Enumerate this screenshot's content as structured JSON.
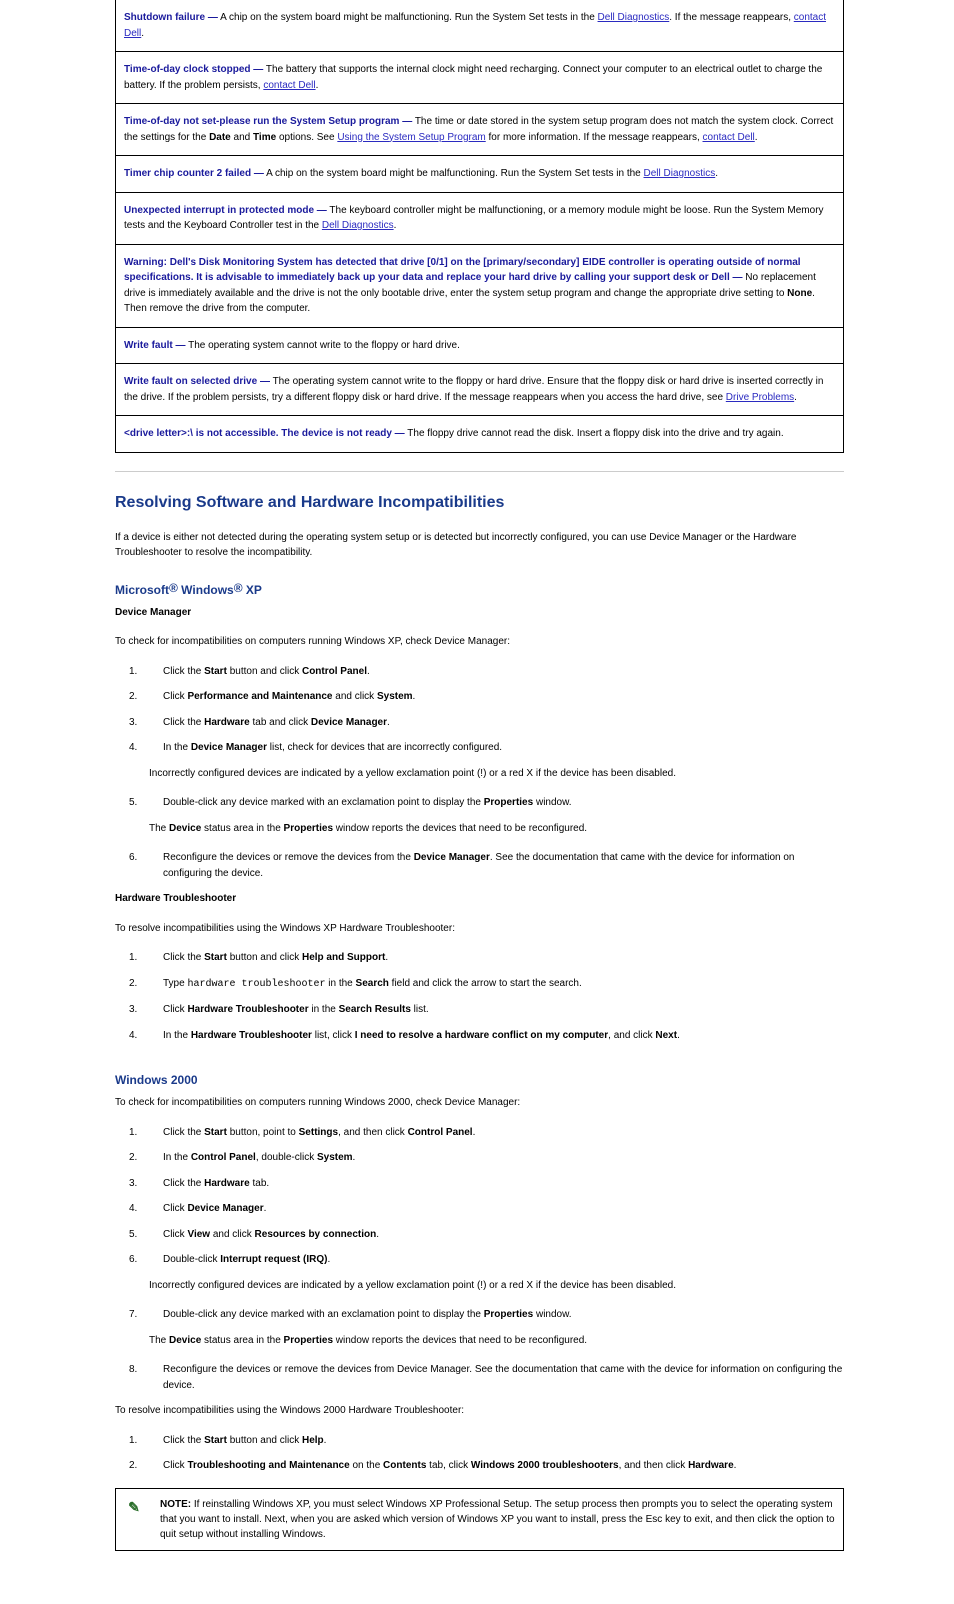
{
  "errors": [
    {
      "title": "Shutdown failure —",
      "pre": "",
      "body_a": " A chip on the system board might be malfunctioning. Run the System Set tests in the ",
      "link1": "Dell Diagnostics",
      "body_b": ". If the message reappears, ",
      "link2": "contact Dell",
      "body_c": "."
    },
    {
      "title": "day clock stopped —",
      "pre": "Time-of-",
      "body_a": " The battery that supports the internal clock might need recharging. Connect your computer to an electrical outlet to charge the battery. If the problem persists, ",
      "link1": "contact Dell",
      "body_b": ".",
      "link2": "",
      "body_c": ""
    },
    {
      "title": "please run the System Setup program —",
      "pre": "Time-of-day not set-",
      "body_a": " The time or date stored in the system setup program does not match the system clock. Correct the settings for the ",
      "bold_a": "Date",
      "mid_a": " and ",
      "bold_b": "Time",
      "mid_b": " options. See ",
      "link1": "Using the System Setup Program",
      "body_b": " for more information. If the message reappears, ",
      "link2": "contact Dell",
      "body_c": "."
    },
    {
      "title": "Timer chip counter 2 failed —",
      "pre": "",
      "body_a": " A chip on the system board might be malfunctioning. Run the System Set tests in the ",
      "link1": "Dell Diagnostics",
      "body_b": ".",
      "link2": "",
      "body_c": ""
    },
    {
      "title": "Unexpected interrupt in protected mode —",
      "pre": "",
      "body_a": " The keyboard controller might be malfunctioning, or a memory module might be loose. Run the System Memory tests and the Keyboard Controller test in the ",
      "link1": "Dell Diagnostics",
      "body_b": ".",
      "link2": "",
      "body_c": ""
    },
    {
      "title": "desk or Dell —",
      "pre": "Warning: Dell's Disk Monitoring System has detected that drive [0/1] on the [primary/secondary] EIDE controller is operating outside of normal specifications. It is advisable to immediately back up your data and replace your hard drive by calling your support ",
      "body_a": " No replacement drive is immediately available and the drive is not the only bootable drive, enter the system setup program and change the appropriate drive setting to ",
      "bold_a": "None",
      "mid_a": ". Then remove the drive from the computer.",
      "link1": "",
      "body_b": "",
      "link2": "",
      "body_c": ""
    },
    {
      "title": "Write fault —",
      "pre": "",
      "body_a": " The operating system cannot write to the floppy or hard drive.",
      "link1": "",
      "body_b": "",
      "link2": "",
      "body_c": ""
    },
    {
      "title": "Write fault on selected drive —",
      "pre": "",
      "body_a": " The operating system cannot write to the floppy or hard drive. Ensure that the floppy disk or hard drive is inserted correctly in the drive. If the problem persists, try a different floppy disk or hard drive. If the message reappears when you access the hard drive, see ",
      "link1": "Drive Problems",
      "body_b": ".",
      "link2": "",
      "body_c": ""
    },
    {
      "title": ">:\\ is not accessible. The device is not ready —",
      "pre": "<drive letter",
      "body_a": " The floppy drive cannot read the disk. Insert a floppy disk into the drive and try again.",
      "link1": "",
      "body_b": "",
      "link2": "",
      "body_c": ""
    }
  ],
  "section": {
    "heading": "Resolving Software and Hardware Incompatibilities",
    "intro": "If a device is either not detected during the operating system setup or is detected but incorrectly configured, you can use Device Manager or the Hardware Troubleshooter to resolve the incompatibility.",
    "h_win": "Microsoft",
    "h_win2": " Windows",
    "h_win3": " XP",
    "dm_heading": "Device Manager",
    "dm_intro": "To check for incompatibilities on computers running Windows XP, check Device Manager:",
    "steps_dm": [
      {
        "n": "1.",
        "t": "Click the ",
        "b1": "Start",
        "m1": " button and click ",
        "b2": "Control Panel",
        "m2": "."
      },
      {
        "n": "2.",
        "t": "Click ",
        "b1": "Performance and Maintenance",
        "m1": " and click ",
        "b2": "System",
        "m2": "."
      },
      {
        "n": "3.",
        "t": "Click the ",
        "b1": "Hardware",
        "m1": " tab and click ",
        "b2": "Device Manager",
        "m2": "."
      },
      {
        "n": "4.",
        "t": "In the ",
        "b1": "Device Manager",
        "m1": " list, check for devices that are incorrectly configured.",
        "b2": "",
        "m2": ""
      }
    ],
    "dm_tail1": "Incorrectly configured devices are indicated by a yellow exclamation point (",
    "dm_tail_b1": "!",
    "dm_tail2": ") or a red ",
    "dm_tail_b2": "X",
    "dm_tail3": " if the device has been disabled.",
    "step5": {
      "n": "5.",
      "t": "Double-click any device marked with an exclamation point to display the ",
      "b1": "Properties",
      "m1": " window."
    },
    "dm_status_a": "The ",
    "dm_status_b": "Device",
    "dm_status_c": " status area in the ",
    "dm_status_d": "Properties",
    "dm_status_e": " window reports the devices that need to be reconfigured.",
    "step6": {
      "n": "6.",
      "t": "Reconfigure the devices or remove the devices from the ",
      "b1": "Device Manager",
      "m1": ". See the documentation that came with the device for information on configuring the device."
    },
    "ht_heading": "Hardware Troubleshooter",
    "ht_intro": "To resolve incompatibilities using the Windows XP Hardware Troubleshooter:",
    "steps_ht": [
      {
        "n": "1.",
        "t": "Click the ",
        "b1": "Start",
        "m1": " button and click ",
        "b2": "Help and Support",
        "m2": "."
      },
      {
        "n": "2.",
        "t": "Type ",
        "code": "hardware troubleshooter",
        "m1": " in the ",
        "b2": "Search",
        "m2": " field and click the arrow to start the search."
      },
      {
        "n": "3.",
        "t": "Click ",
        "b1": "Hardware Troubleshooter",
        "m1": " in the ",
        "b2": "Search Results",
        "m2": " list."
      },
      {
        "n": "4.",
        "t": "In the ",
        "b1": "Hardware Troubleshooter",
        "m1": " list, click ",
        "b2": "I need to resolve a hardware conflict on my computer",
        "m2": ", and click ",
        "b3": "Next",
        "m3": "."
      }
    ],
    "h_win2k": "Windows 2000",
    "w2k_intro": "To check for incompatibilities on computers running Windows 2000, check Device Manager:",
    "steps_w2k": [
      {
        "n": "1.",
        "t": "Click the ",
        "b1": "Start",
        "m1": " button, point to ",
        "b2": "Settings",
        "m2": ", and then click ",
        "b3": "Control Panel",
        "m3": "."
      },
      {
        "n": "2.",
        "t": "In the ",
        "b1": "Control Panel",
        "m1": ", double-click ",
        "b2": "System",
        "m2": "."
      },
      {
        "n": "3.",
        "t": "Click the ",
        "b1": "Hardware",
        "m1": " tab.",
        "b2": "",
        "m2": ""
      },
      {
        "n": "4.",
        "t": "Click ",
        "b1": "Device Manager",
        "m1": ".",
        "b2": "",
        "m2": ""
      },
      {
        "n": "5.",
        "t": "Click ",
        "b1": "View",
        "m1": " and click ",
        "b2": "Resources by connection",
        "m2": "."
      },
      {
        "n": "6.",
        "t": "Double-click ",
        "b1": "Interrupt request (IRQ)",
        "m1": ".",
        "b2": "",
        "m2": ""
      }
    ],
    "w2k_tail1": "Incorrectly configured devices are indicated by a yellow exclamation point (",
    "w2k_tail_b1": "!",
    "w2k_tail2": ") or a red ",
    "w2k_tail_b2": "X",
    "w2k_tail3": " if the device has been disabled.",
    "w2k_step7": {
      "n": "7.",
      "t": "Double-click any device marked with an exclamation point to display the ",
      "b1": "Properties",
      "m1": " window."
    },
    "w2k_status_a": "The ",
    "w2k_status_b": "Device",
    "w2k_status_c": " status area in the ",
    "w2k_status_d": "Properties",
    "w2k_status_e": " window reports the devices that need to be reconfigured.",
    "w2k_step8": {
      "n": "8.",
      "t": "Reconfigure the devices or remove the devices from Device Manager. See the documentation that came with the device for information on configuring the device."
    },
    "ht2_intro": "To resolve incompatibilities using the Windows 2000 Hardware Troubleshooter:",
    "steps_ht2": [
      {
        "n": "1.",
        "t": "Click the ",
        "b1": "Start",
        "m1": " button and click ",
        "b2": "Help",
        "m2": "."
      },
      {
        "n": "2.",
        "t": "Click ",
        "b1": "Troubleshooting and Maintenance",
        "m1": " on the ",
        "b2": "Contents",
        "m2": " tab, click ",
        "b3": "Windows 2000 troubleshooters",
        "m3": ", and then click ",
        "b4": "Hardware",
        "m4": "."
      }
    ],
    "note_label": "NOTE:",
    "note_text": " If reinstalling Windows XP, you must select Windows XP Professional Setup. The setup process then prompts you to select the operating system that you want to install. Next, when you are asked which version of Windows XP you want to install, press the Esc key to exit, and then click the option to quit setup without installing Windows."
  }
}
